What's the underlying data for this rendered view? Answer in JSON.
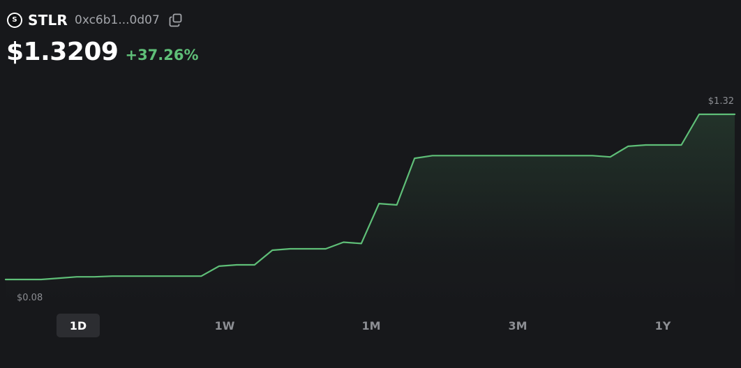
{
  "token": {
    "logo_letter": "S",
    "symbol": "STLR",
    "address": "0xc6b1...0d07"
  },
  "price": {
    "value": "$1.3209",
    "change": "+37.26%"
  },
  "colors": {
    "background": "#17181b",
    "line": "#5fbf78",
    "positive": "#5fbf78",
    "muted_text": "#8c8e93"
  },
  "chart_data": {
    "type": "line",
    "max_label": "$1.32",
    "min_label": "$0.08",
    "ylim": [
      0.08,
      1.32
    ],
    "grid": false,
    "x": [
      0,
      1,
      2,
      3,
      4,
      5,
      6,
      7,
      8,
      9,
      10,
      11,
      12,
      13,
      14,
      15,
      16,
      17,
      18,
      19,
      20,
      21,
      22,
      23,
      24,
      25,
      26,
      27,
      28,
      29,
      30,
      31,
      32,
      33,
      34,
      35,
      36,
      37,
      38,
      39,
      40,
      41
    ],
    "series": [
      {
        "values": [
          0.08,
          0.08,
          0.08,
          0.09,
          0.1,
          0.1,
          0.105,
          0.105,
          0.105,
          0.105,
          0.105,
          0.105,
          0.18,
          0.19,
          0.19,
          0.3,
          0.31,
          0.31,
          0.31,
          0.36,
          0.35,
          0.65,
          0.64,
          0.99,
          1.01,
          1.01,
          1.01,
          1.01,
          1.01,
          1.01,
          1.01,
          1.01,
          1.01,
          1.01,
          1.0,
          1.08,
          1.09,
          1.09,
          1.09,
          1.32,
          1.32,
          1.32
        ]
      }
    ]
  },
  "ranges": [
    {
      "label": "1D",
      "active": true
    },
    {
      "label": "1W",
      "active": false
    },
    {
      "label": "1M",
      "active": false
    },
    {
      "label": "3M",
      "active": false
    },
    {
      "label": "1Y",
      "active": false
    }
  ]
}
